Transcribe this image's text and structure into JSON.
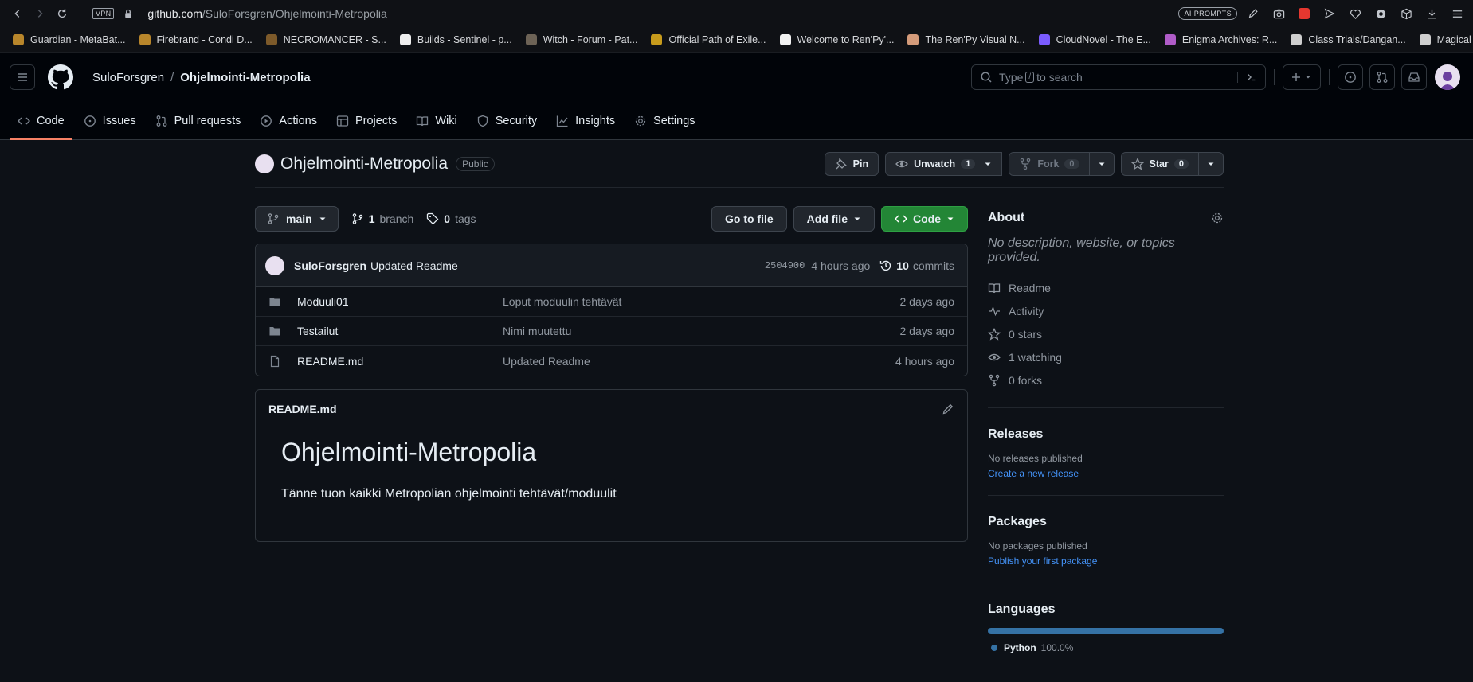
{
  "browser": {
    "vpn_label": "VPN",
    "url_host": "github.com",
    "url_path": "/SuloForsgren/Ohjelmointi-Metropolia",
    "ai_prompts_label": "AI PROMPTS",
    "bookmarks": [
      {
        "label": "Guardian - MetaBat...",
        "color": "#b8862b"
      },
      {
        "label": "Firebrand - Condi D...",
        "color": "#b8862b"
      },
      {
        "label": "NECROMANCER - S...",
        "color": "#7d5a2a"
      },
      {
        "label": "Builds - Sentinel - p...",
        "color": "#eeeeee"
      },
      {
        "label": "Witch - Forum - Pat...",
        "color": "#6d6356"
      },
      {
        "label": "Official Path of Exile...",
        "color": "#c79b1c"
      },
      {
        "label": "Welcome to Ren'Py'...",
        "color": "#f2f2f2"
      },
      {
        "label": "The Ren'Py Visual N...",
        "color": "#d49b7a"
      },
      {
        "label": "CloudNovel - The E...",
        "color": "#7b5cff"
      },
      {
        "label": "Enigma Archives: R...",
        "color": "#b05cc8"
      },
      {
        "label": "Class Trials/Dangan...",
        "color": "#cfcfcf"
      },
      {
        "label": "Magical Girl Miracle...",
        "color": "#cfcfcf"
      }
    ],
    "more": "»"
  },
  "header": {
    "owner": "SuloForsgren",
    "separator": "/",
    "repo": "Ohjelmointi-Metropolia",
    "search_pre": "Type",
    "search_key": "/",
    "search_post": "to search",
    "add_label": "+"
  },
  "tabs": [
    {
      "label": "Code"
    },
    {
      "label": "Issues"
    },
    {
      "label": "Pull requests"
    },
    {
      "label": "Actions"
    },
    {
      "label": "Projects"
    },
    {
      "label": "Wiki"
    },
    {
      "label": "Security"
    },
    {
      "label": "Insights"
    },
    {
      "label": "Settings"
    }
  ],
  "repo": {
    "title": "Ohjelmointi-Metropolia",
    "visibility": "Public",
    "pin_label": "Pin",
    "unwatch_label": "Unwatch",
    "unwatch_count": "1",
    "fork_label": "Fork",
    "fork_count": "0",
    "star_label": "Star",
    "star_count": "0"
  },
  "filebar": {
    "branch": "main",
    "branch_count": "1",
    "branch_word": "branch",
    "tag_count": "0",
    "tag_word": "tags",
    "go_to_file": "Go to file",
    "add_file": "Add file",
    "code": "Code"
  },
  "commit": {
    "author": "SuloForsgren",
    "message": "Updated Readme",
    "sha": "2504900",
    "age": "4 hours ago",
    "count": "10",
    "count_word": "commits"
  },
  "files": [
    {
      "type": "folder",
      "name": "Moduuli01",
      "message": "Loput moduulin tehtävät",
      "age": "2 days ago"
    },
    {
      "type": "folder",
      "name": "Testailut",
      "message": "Nimi muutettu",
      "age": "2 days ago"
    },
    {
      "type": "file",
      "name": "README.md",
      "message": "Updated Readme",
      "age": "4 hours ago"
    }
  ],
  "readme": {
    "filename": "README.md",
    "heading": "Ohjelmointi-Metropolia",
    "paragraph": "Tänne tuon kaikki Metropolian ohjelmointi tehtävät/moduulit"
  },
  "about": {
    "title": "About",
    "description": "No description, website, or topics provided.",
    "items": [
      {
        "label": "Readme",
        "icon": "book-icon"
      },
      {
        "label": "Activity",
        "icon": "pulse-icon"
      },
      {
        "label": "0 stars",
        "icon": "star-icon"
      },
      {
        "label": "1 watching",
        "icon": "eye-icon"
      },
      {
        "label": "0 forks",
        "icon": "fork-icon"
      }
    ]
  },
  "releases": {
    "title": "Releases",
    "text": "No releases published",
    "link": "Create a new release"
  },
  "packages": {
    "title": "Packages",
    "text": "No packages published",
    "link": "Publish your first package"
  },
  "languages": {
    "title": "Languages",
    "name": "Python",
    "percent": "100.0%",
    "color": "#3572a5"
  }
}
